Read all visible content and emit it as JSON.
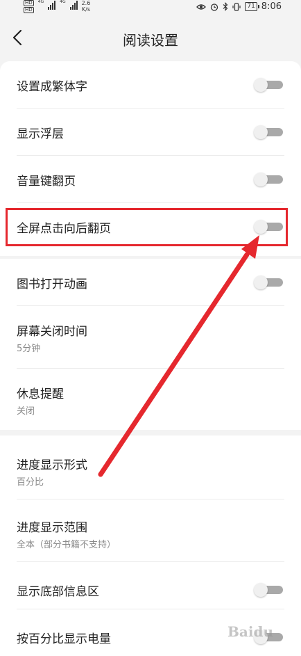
{
  "status_bar": {
    "sim1_label": "HD",
    "sim2_label": "HD",
    "net_type_1": "4G",
    "net_type_2": "4G",
    "speed_value": "2.6",
    "speed_unit": "K/s",
    "battery_level": "71",
    "time": "8:06"
  },
  "header": {
    "title": "阅读设置"
  },
  "settings": {
    "group1": [
      {
        "label": "设置成繁体字",
        "toggle_on": false
      },
      {
        "label": "显示浮层",
        "toggle_on": false
      },
      {
        "label": "音量键翻页",
        "toggle_on": false
      },
      {
        "label": "全屏点击向后翻页",
        "toggle_on": false
      }
    ],
    "group2": [
      {
        "label": "图书打开动画",
        "toggle_on": false
      },
      {
        "label": "屏幕关闭时间",
        "value": "5分钟"
      },
      {
        "label": "休息提醒",
        "value": "关闭"
      }
    ],
    "group3": [
      {
        "label": "进度显示形式",
        "value": "百分比"
      },
      {
        "label": "进度显示范围",
        "value": "全本（部分书籍不支持）"
      },
      {
        "label": "显示底部信息区",
        "toggle_on": false
      },
      {
        "label": "按百分比显示电量",
        "toggle_on": false
      }
    ]
  },
  "annotation": {
    "highlight_color": "#e5282e",
    "arrow_color": "#e5282e"
  },
  "watermark": {
    "text": "Baidu"
  },
  "colors": {
    "background": "#f3f3f3",
    "card": "#ffffff",
    "toggle_track_off": "#a9a9a9",
    "subtext": "#8a8a8a"
  }
}
